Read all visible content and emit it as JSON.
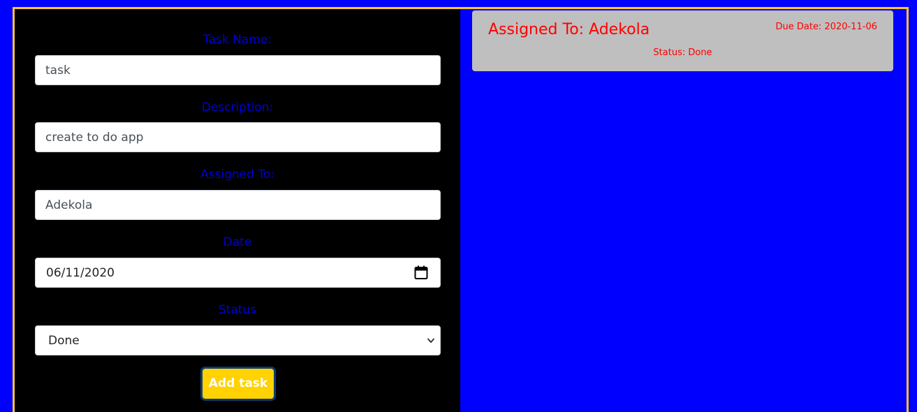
{
  "form": {
    "task_name": {
      "label": "Task Name:",
      "value": "task"
    },
    "description": {
      "label": "Description:",
      "value": "create to do app"
    },
    "assigned_to": {
      "label": "Assigned To:",
      "value": "Adekola"
    },
    "date": {
      "label": "Date",
      "value": "06/11/2020",
      "icon": "calendar-icon"
    },
    "status": {
      "label": "Status",
      "selected": "Done",
      "icon": "chevron-down-icon"
    },
    "submit_label": "Add task"
  },
  "tasks": [
    {
      "assigned": "Assigned To: Adekola",
      "due": "Due Date: 2020-11-06",
      "status": "Status: Done"
    }
  ],
  "colors": {
    "background": "#0000ff",
    "form_panel": "#000000",
    "frame_border": "#ffc81e",
    "label_text": "#0000d8",
    "button": "#ffd200",
    "card": "#bfbfbf",
    "card_text": "#ff0000"
  }
}
